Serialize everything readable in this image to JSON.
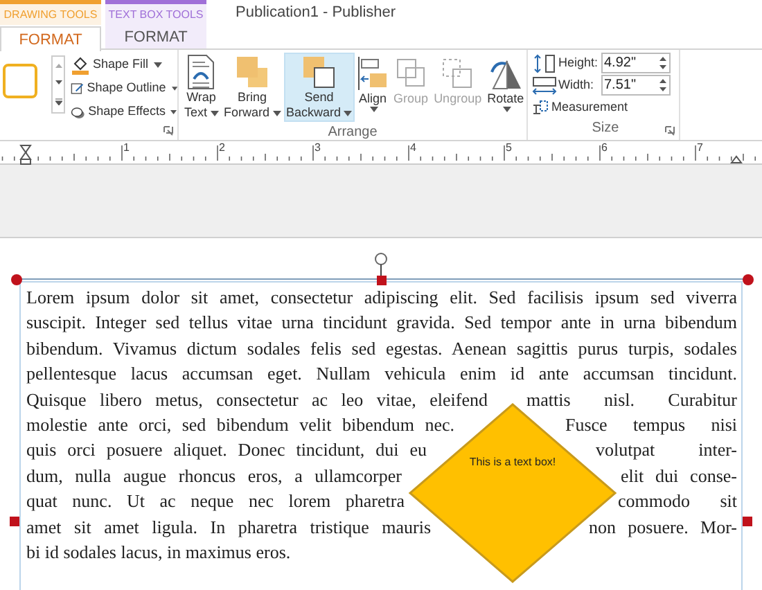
{
  "window": {
    "title": "Publication1 - Publisher"
  },
  "context_groups": [
    {
      "title": "DRAWING TOOLS",
      "color": "#f0a030",
      "tab": {
        "label": "FORMAT",
        "selected": true
      }
    },
    {
      "title": "TEXT BOX TOOLS",
      "color": "#a070d8",
      "tab": {
        "label": "FORMAT",
        "selected": false
      }
    }
  ],
  "ribbon": {
    "shape_commands": [
      {
        "kind": "fill",
        "label": "Shape Fill"
      },
      {
        "kind": "outline",
        "label": "Shape Outline"
      },
      {
        "kind": "effects",
        "label": "Shape Effects"
      }
    ],
    "arrange": {
      "label": "Arrange",
      "buttons": [
        {
          "kind": "wrap",
          "lines": [
            "Wrap",
            "Text"
          ],
          "dropdown": true,
          "disabled": false,
          "highlighted": false
        },
        {
          "kind": "bring",
          "lines": [
            "Bring",
            "Forward"
          ],
          "dropdown": true,
          "disabled": false,
          "highlighted": false
        },
        {
          "kind": "send",
          "lines": [
            "Send",
            "Backward"
          ],
          "dropdown": true,
          "disabled": false,
          "highlighted": true
        },
        {
          "kind": "align",
          "lines": [
            "Align"
          ],
          "dropdown": true,
          "disabled": false,
          "highlighted": false
        },
        {
          "kind": "group",
          "lines": [
            "Group"
          ],
          "dropdown": false,
          "disabled": true,
          "highlighted": false
        },
        {
          "kind": "ungroup",
          "lines": [
            "Ungroup"
          ],
          "dropdown": false,
          "disabled": true,
          "highlighted": false
        },
        {
          "kind": "rotate",
          "lines": [
            "Rotate"
          ],
          "dropdown": true,
          "disabled": false,
          "highlighted": false
        }
      ]
    },
    "size": {
      "label": "Size",
      "fields": [
        {
          "kind": "height",
          "label": "Height:",
          "value": "4.92\""
        },
        {
          "kind": "width",
          "label": "Width:",
          "value": "7.51\""
        }
      ],
      "measurement": "Measurement"
    }
  },
  "ruler": {
    "labels": [
      "1",
      "2",
      "3",
      "4",
      "5",
      "6",
      "7"
    ]
  },
  "document": {
    "lines": [
      {
        "left": "Lorem ipsum dolor sit amet, consectetur adipiscing elit. Sed facilisis ipsum sed viverra"
      },
      {
        "left": "suscipit. Integer sed tellus vitae urna tincidunt gravida. Sed tempor ante in urna bibendum"
      },
      {
        "left": "bibendum. Vivamus dictum sodales felis sed egestas. Aenean sagittis purus turpis, sodales"
      },
      {
        "left": "pellentesque lacus accumsan eget. Nullam vehicula enim id ante accumsan tincidunt."
      },
      {
        "left": "Quisque libero metus, consectetur ac leo vitae, eleifend",
        "right": "mattis nisl. Curabitur"
      },
      {
        "left": "molestie ante orci, sed bibendum velit bibendum nec.",
        "right": "Fusce tempus nisi"
      },
      {
        "left": "quis orci posuere aliquet. Donec tincidunt, dui eu",
        "right": "volutpat inter-"
      },
      {
        "left": "dum, nulla augue rhoncus eros, a ullamcorper",
        "right": "elit dui conse-"
      },
      {
        "left": "quat nunc. Ut ac neque nec lorem pharetra",
        "right": "commodo sit"
      },
      {
        "left": "amet sit amet ligula. In pharetra tristique mauris",
        "right": "non posuere. Mor-"
      },
      {
        "left": "bi id sodales lacus, in maximus eros.",
        "last": true
      }
    ],
    "text_box": {
      "text": "This is a text box!"
    }
  }
}
